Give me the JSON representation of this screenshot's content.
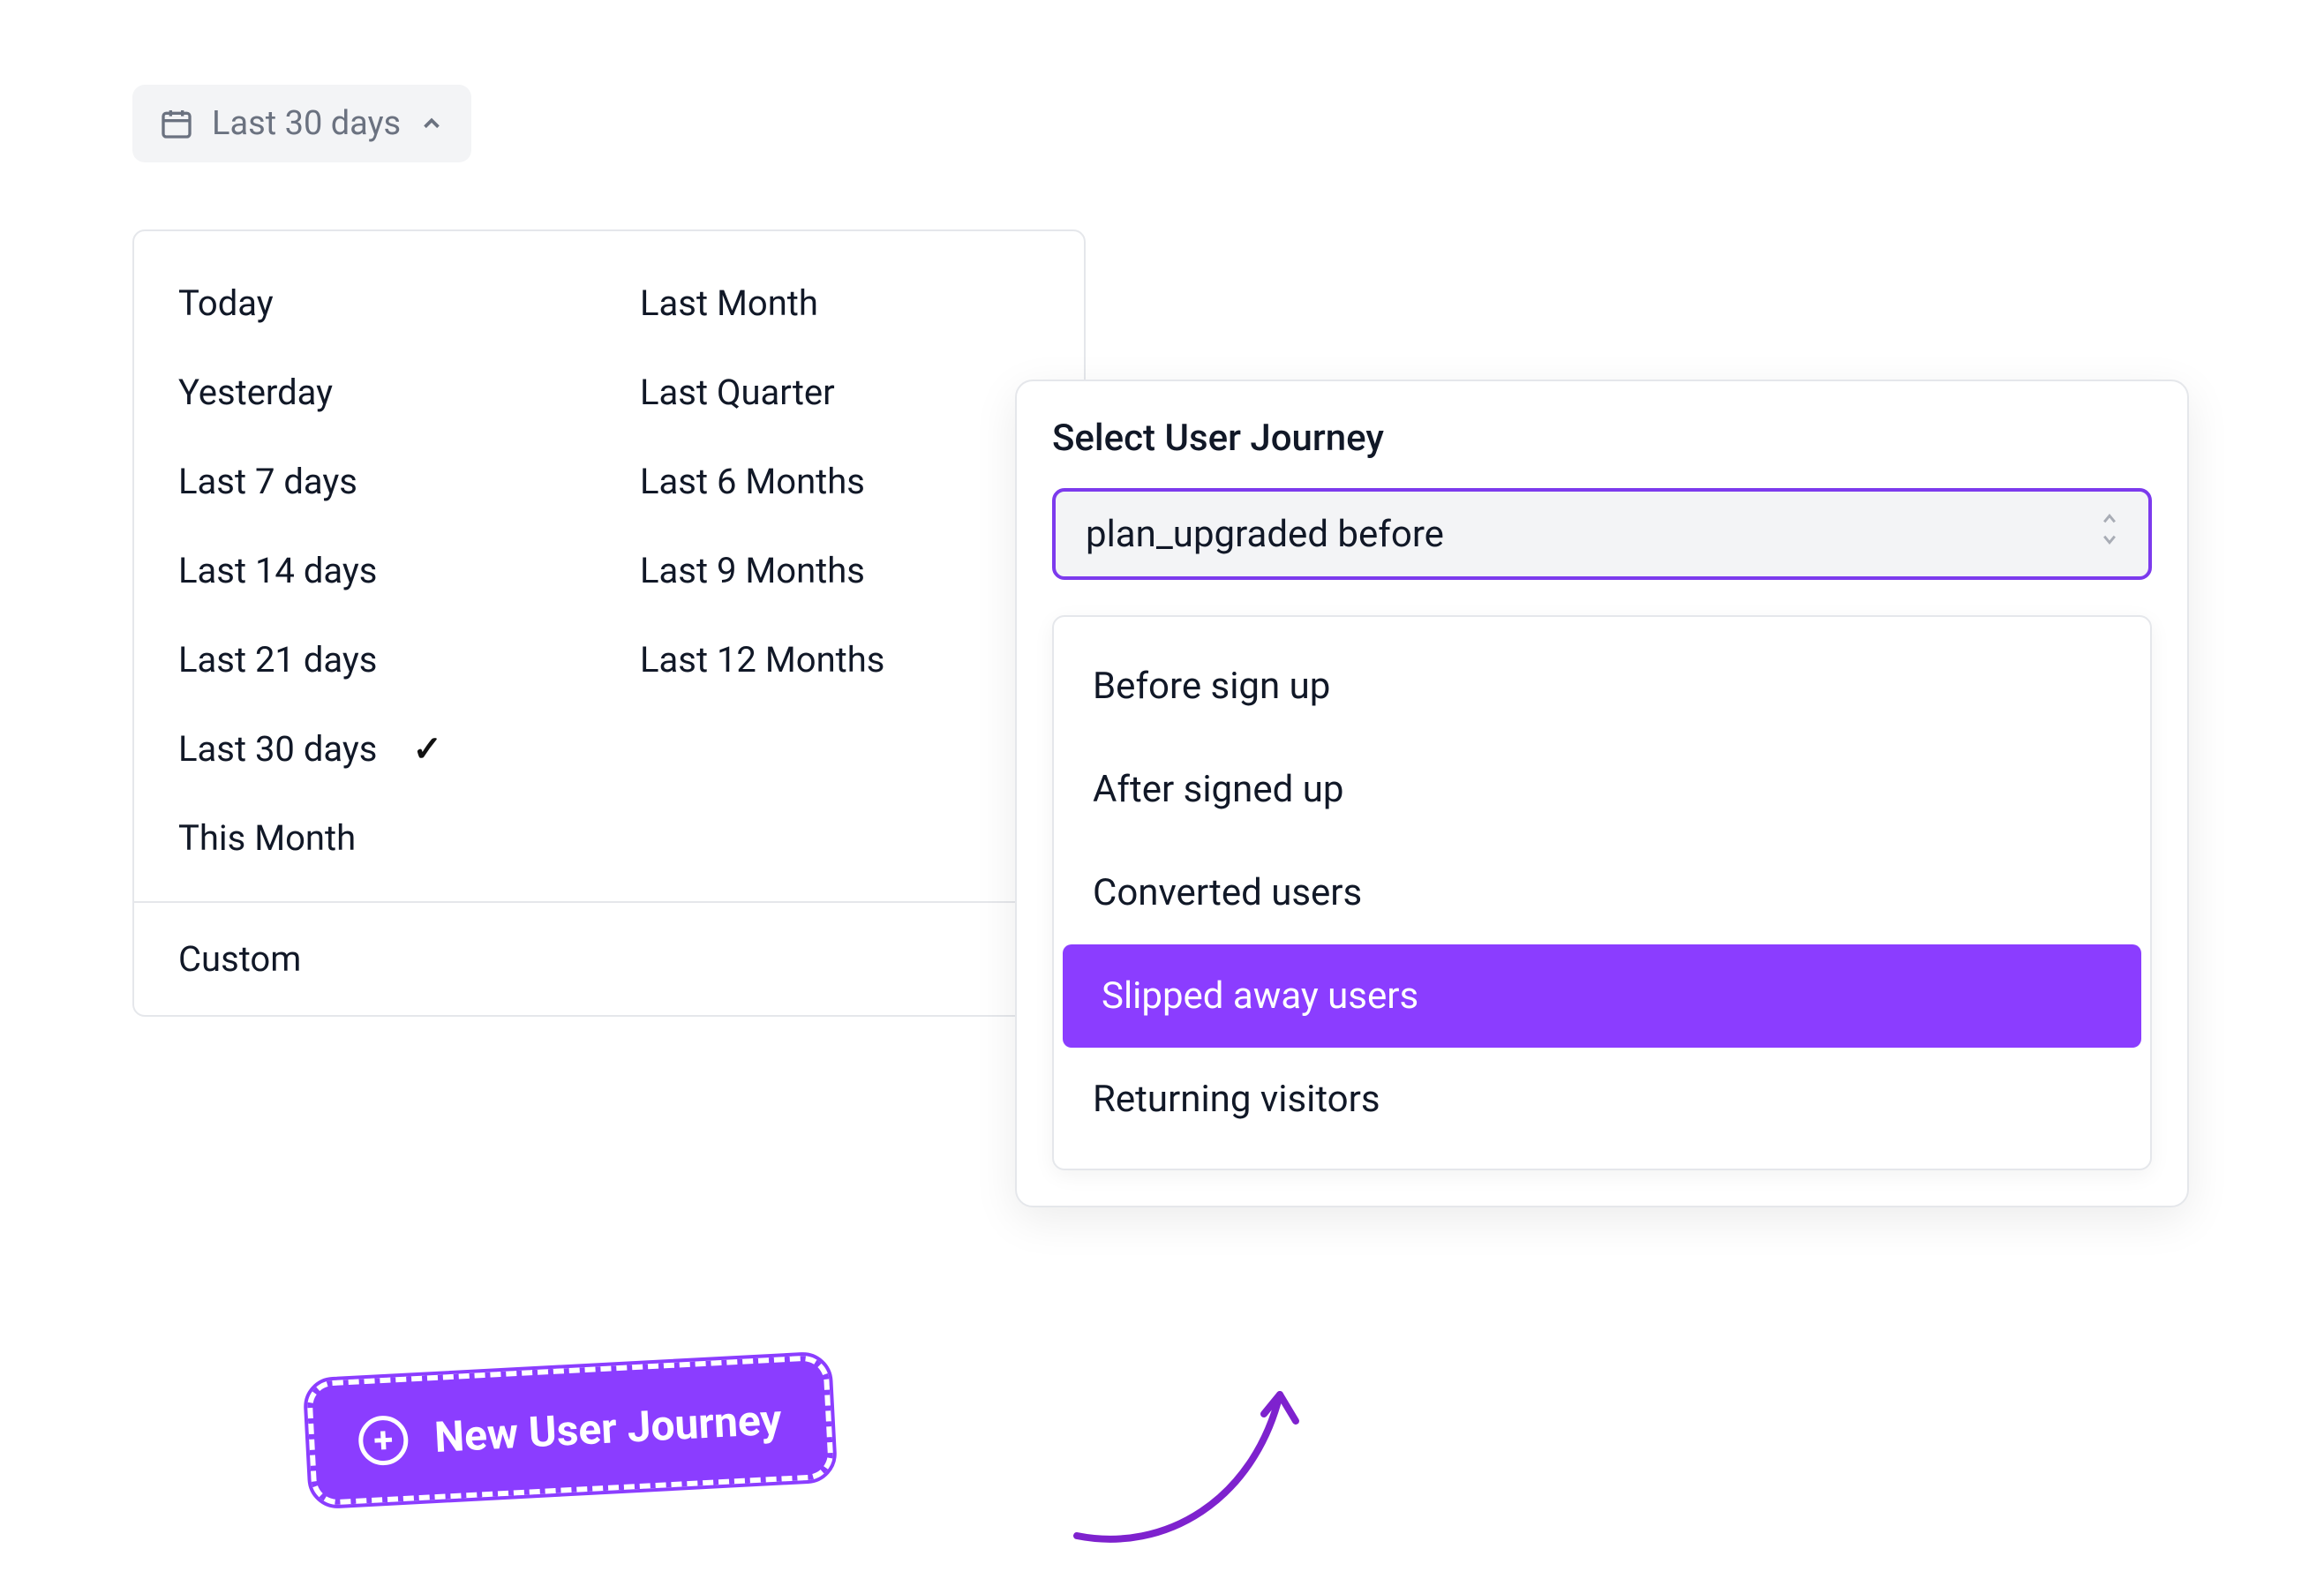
{
  "date_picker": {
    "selected_label": "Last 30 days",
    "columns": [
      [
        {
          "label": "Today",
          "checked": false
        },
        {
          "label": "Yesterday",
          "checked": false
        },
        {
          "label": "Last 7 days",
          "checked": false
        },
        {
          "label": "Last 14 days",
          "checked": false
        },
        {
          "label": "Last 21 days",
          "checked": false
        },
        {
          "label": "Last 30 days",
          "checked": true
        },
        {
          "label": "This Month",
          "checked": false
        }
      ],
      [
        {
          "label": "Last Month",
          "checked": false
        },
        {
          "label": "Last Quarter",
          "checked": false
        },
        {
          "label": "Last 6 Months",
          "checked": false
        },
        {
          "label": "Last 9 Months",
          "checked": false
        },
        {
          "label": "Last 12 Months",
          "checked": false
        }
      ]
    ],
    "custom_label": "Custom"
  },
  "journey": {
    "title": "Select User Journey",
    "selected": "plan_upgraded before",
    "options": [
      {
        "label": "Before sign up",
        "active": false
      },
      {
        "label": "After signed up",
        "active": false
      },
      {
        "label": "Converted users",
        "active": false
      },
      {
        "label": "Slipped away users",
        "active": true
      },
      {
        "label": "Returning visitors",
        "active": false
      }
    ]
  },
  "new_journey_button": "New User Journey",
  "colors": {
    "accent": "#8b3dff",
    "accent_border": "#7c3aed"
  }
}
